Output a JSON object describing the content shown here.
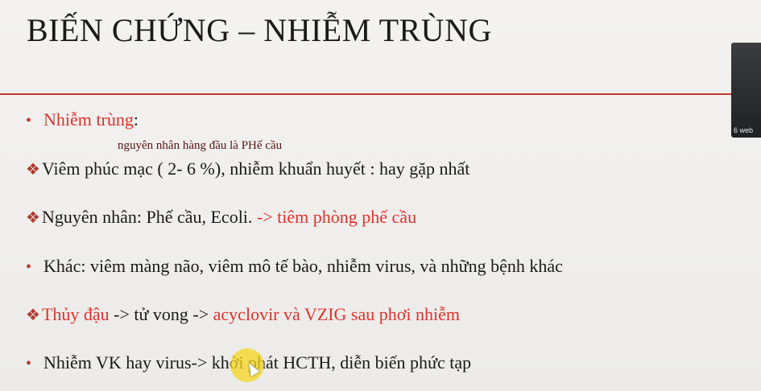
{
  "title": "BIẾN CHỨNG – NHIỄM TRÙNG",
  "annotation": "nguyên nhân hàng đầu là PHế cầu",
  "camera_label": "6 web",
  "lines": [
    {
      "marker": "•",
      "parts": [
        "Nhiễm trùng",
        ":"
      ]
    },
    {
      "marker": "❖",
      "parts": [
        "Viêm phúc mạc ( 2- 6 %), nhiễm khuẩn huyết : hay gặp nhất"
      ]
    },
    {
      "marker": "❖",
      "parts": [
        "Nguyên nhân: Phế cầu, Ecoli. ",
        "-> tiêm phòng phế cầu"
      ]
    },
    {
      "marker": "•",
      "parts": [
        "Khác: viêm màng não, viêm mô tế bào, nhiễm virus, và những bệnh khác"
      ]
    },
    {
      "marker": "❖",
      "parts": [
        "Thủy đậu",
        " -> tử vong -> ",
        "acyclovir và VZIG sau phơi nhiễm"
      ]
    },
    {
      "marker": "•",
      "parts": [
        "Nhiễm VK hay virus-> khởi phát HCTH, diễn biến phức tạp"
      ]
    }
  ]
}
